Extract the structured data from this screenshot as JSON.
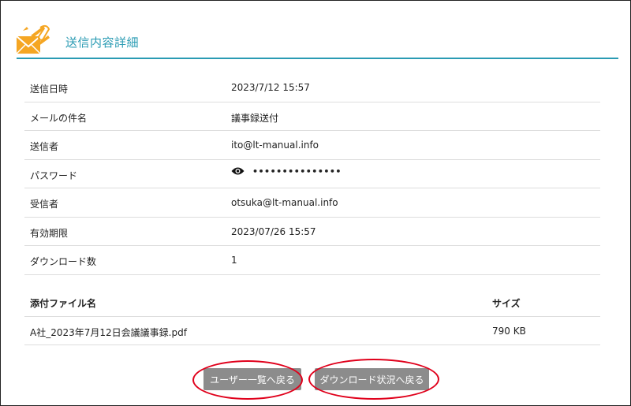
{
  "header": {
    "title": "送信内容詳細",
    "icon": "mail-send-icon"
  },
  "details": [
    {
      "label": "送信日時",
      "value": "2023/7/12 15:57"
    },
    {
      "label": "メールの件名",
      "value": "議事録送付"
    },
    {
      "label": "送信者",
      "value": "ito@lt-manual.info"
    },
    {
      "label": "パスワード",
      "value": "•••••••••••••••",
      "icon": "eye-icon"
    },
    {
      "label": "受信者",
      "value": "otsuka@lt-manual.info"
    },
    {
      "label": "有効期限",
      "value": "2023/07/26 15:57"
    },
    {
      "label": "ダウンロード数",
      "value": "1"
    }
  ],
  "files": {
    "headers": {
      "name": "添付ファイル名",
      "size": "サイズ"
    },
    "rows": [
      {
        "name": "A社_2023年7月12日会議議事録.pdf",
        "size": "790 KB"
      }
    ]
  },
  "buttons": {
    "back_to_users": "ユーザー一覧へ戻る",
    "back_to_download_status": "ダウンロード状況へ戻る"
  },
  "colors": {
    "accent": "#2a9bb3",
    "button": "#8c8c8c",
    "highlight": "#e0001b",
    "icon_orange": "#f5a623"
  }
}
